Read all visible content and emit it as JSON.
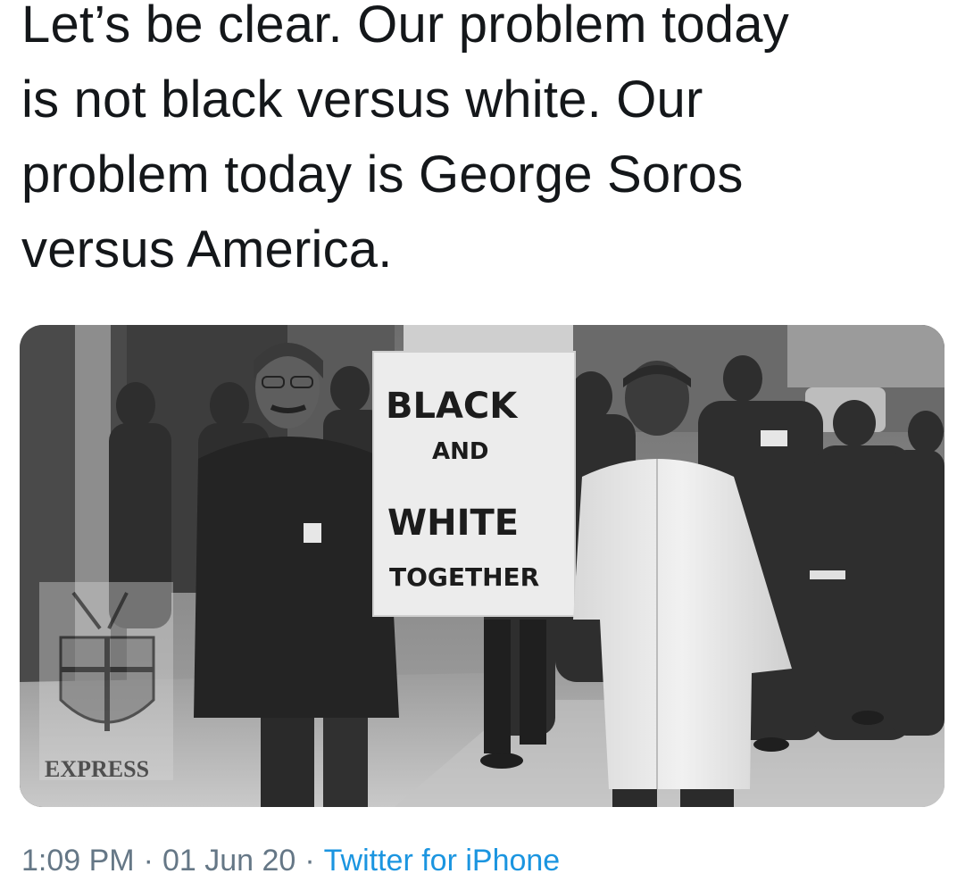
{
  "tweet": {
    "text_lines": [
      "Let’s be clear. Our problem today",
      "is not black versus white. Our",
      "problem today is George Soros",
      "versus America."
    ],
    "time": "1:09 PM",
    "date": "01 Jun 20",
    "separator": "·",
    "source": "Twitter for iPhone",
    "source_color": "#1b95e0",
    "meta_color": "#657786"
  },
  "photo": {
    "style": "black-and-white",
    "sign": {
      "line1": "BLACK",
      "line2": "AND",
      "line3": "WHITE",
      "line4": "TOGETHER"
    },
    "watermark": {
      "label": "EXPRESS",
      "icon": "crusader-shield-icon"
    }
  }
}
